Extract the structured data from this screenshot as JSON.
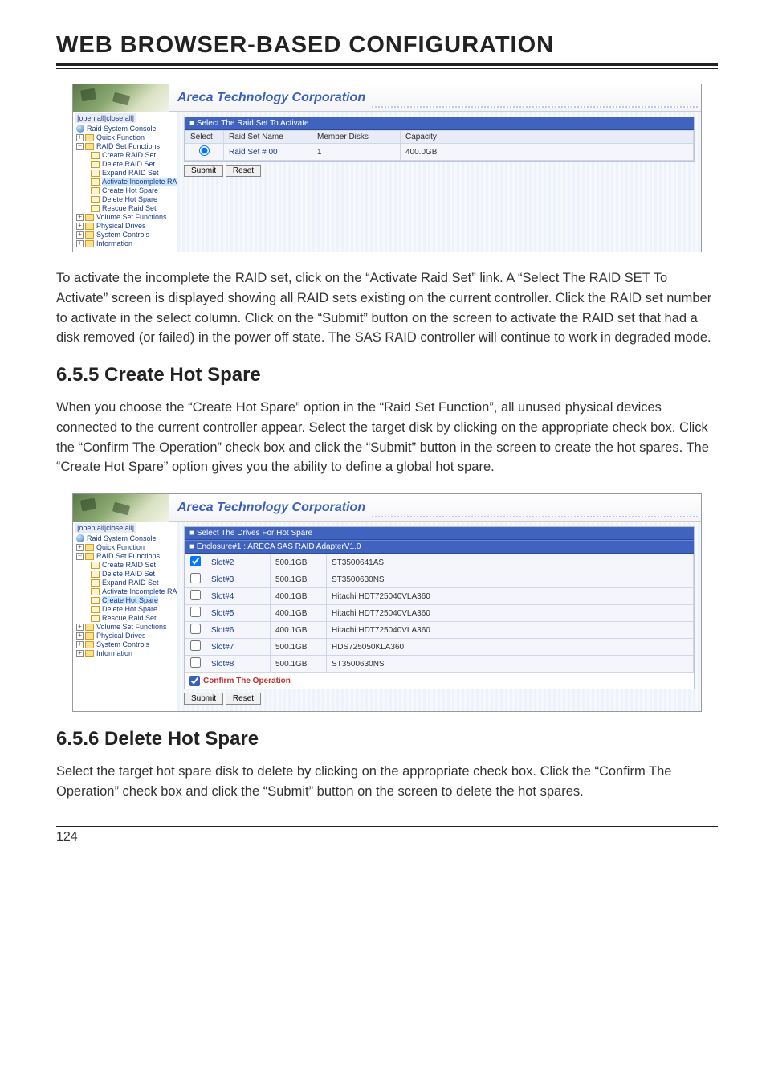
{
  "header": "WEB BROWSER-BASED CONFIGURATION",
  "banner_title": "Areca Technology Corporation",
  "side_toggle": "|open all|close all|",
  "tree1": {
    "root": "Raid System Console",
    "quick": "Quick Function",
    "raidset": "RAID Set Functions",
    "children": [
      "Create RAID Set",
      "Delete RAID Set",
      "Expand RAID Set",
      "Activate Incomplete RAID S",
      "Create Hot Spare",
      "Delete Hot Spare",
      "Rescue Raid Set"
    ],
    "vol": "Volume Set Functions",
    "phy": "Physical Drives",
    "sys": "System Controls",
    "info": "Information"
  },
  "shot1": {
    "section": "■ Select The Raid Set To Activate",
    "headers": [
      "Select",
      "Raid Set Name",
      "Member Disks",
      "Capacity"
    ],
    "row": {
      "name": "Raid Set # 00",
      "disks": "1",
      "cap": "400.0GB"
    },
    "submit": "Submit",
    "reset": "Reset"
  },
  "para1": "To activate the incomplete the RAID set, click on the “Activate Raid Set” link. A “Select The RAID SET To Activate” screen is displayed showing all RAID sets existing on the current controller. Click the RAID set number to activate in the select column. Click on the “Submit” button on the screen to activate the RAID set that had a disk removed (or failed) in the power off state. The SAS RAID controller will continue to work in degraded mode.",
  "h655": "6.5.5 Create Hot Spare",
  "para2": "When you choose the “Create Hot Spare” option in the “Raid Set Function”, all unused physical devices connected to the current controller appear. Select the target disk by clicking on the appropriate check box. Click the “Confirm The Operation” check box and click the “Submit” button in the screen to create the hot spares. The “Create Hot Spare” option gives you the ability to define a global hot spare.",
  "tree2_highlight_index": 4,
  "shot2": {
    "section": "■ Select The Drives For Hot Spare",
    "enclosure": "■ Enclosure#1 : ARECA SAS RAID AdapterV1.0",
    "rows": [
      {
        "slot": "Slot#2",
        "cap": "500.1GB",
        "model": "ST3500641AS"
      },
      {
        "slot": "Slot#3",
        "cap": "500.1GB",
        "model": "ST3500630NS"
      },
      {
        "slot": "Slot#4",
        "cap": "400.1GB",
        "model": "Hitachi HDT725040VLA360"
      },
      {
        "slot": "Slot#5",
        "cap": "400.1GB",
        "model": "Hitachi HDT725040VLA360"
      },
      {
        "slot": "Slot#6",
        "cap": "400.1GB",
        "model": "Hitachi HDT725040VLA360"
      },
      {
        "slot": "Slot#7",
        "cap": "500.1GB",
        "model": "HDS725050KLA360"
      },
      {
        "slot": "Slot#8",
        "cap": "500.1GB",
        "model": "ST3500630NS"
      }
    ],
    "confirm": "Confirm The Operation",
    "submit": "Submit",
    "reset": "Reset"
  },
  "h656": "6.5.6 Delete Hot Spare",
  "para3": "Select the target hot spare disk to delete by clicking on the appropriate check box. Click the “Confirm The Operation” check box and click the “Submit” button on the screen to delete the hot spares.",
  "page_num": "124"
}
